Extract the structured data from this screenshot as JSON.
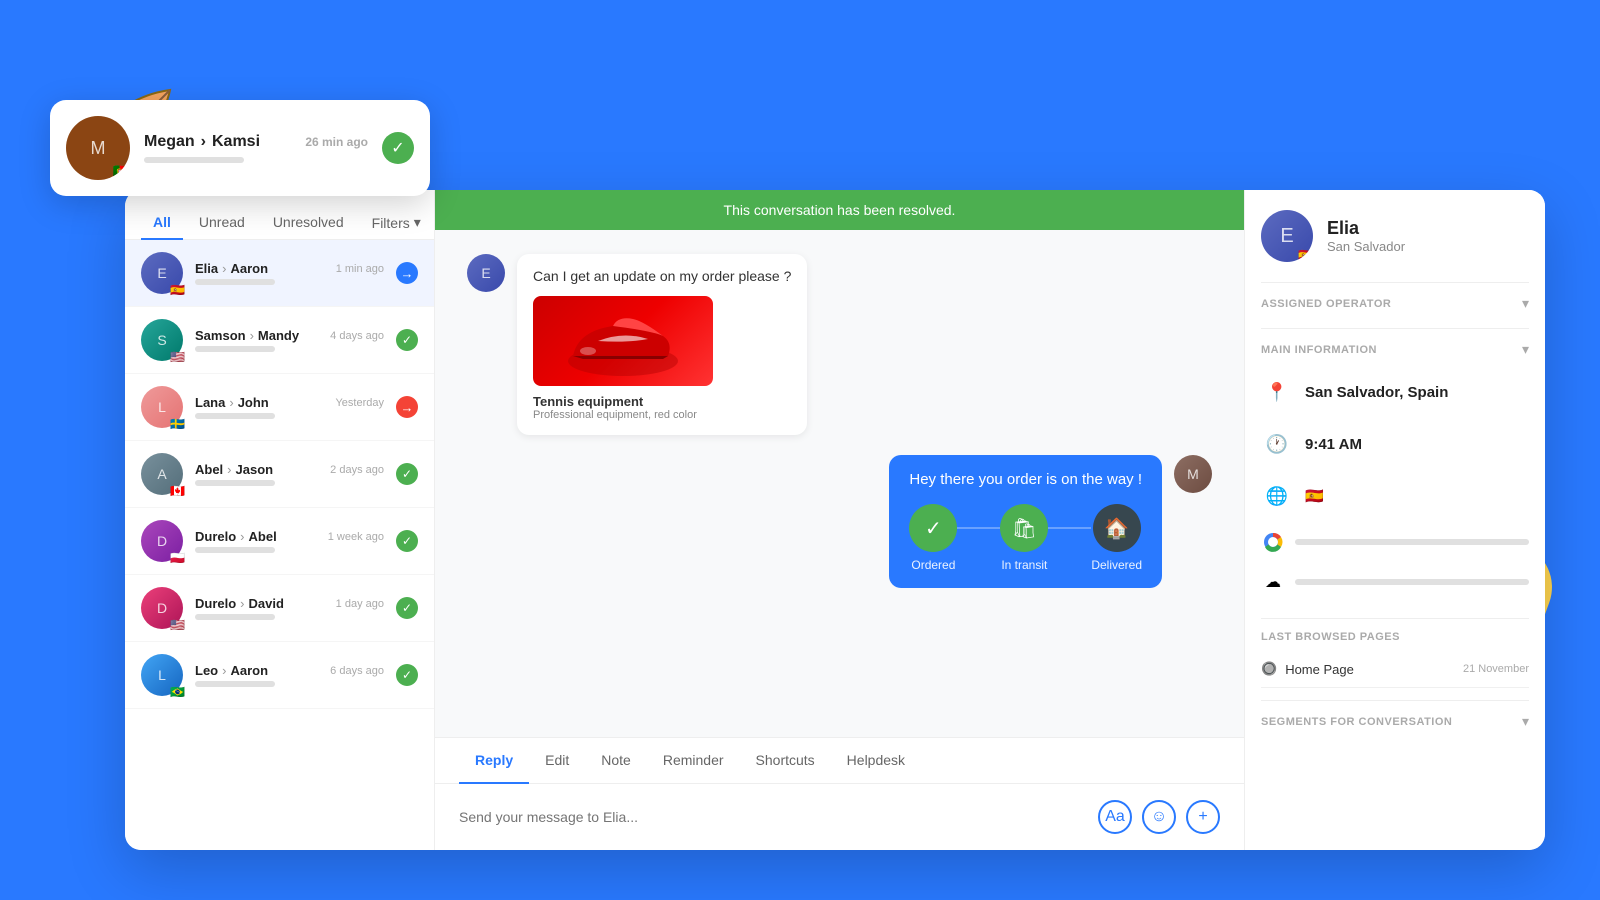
{
  "background_color": "#2979FF",
  "tabs": {
    "all": "All",
    "unread": "Unread",
    "unresolved": "Unresolved",
    "filters": "Filters"
  },
  "conversations": [
    {
      "id": "elia-aaron",
      "from": "Elia",
      "to": "Aaron",
      "time": "1 min ago",
      "flag": "🇪🇸",
      "status": "arrow",
      "avatar_class": "av-elia",
      "active": true
    },
    {
      "id": "samson-mandy",
      "from": "Samson",
      "to": "Mandy",
      "time": "4 days ago",
      "flag": "🇺🇸",
      "status": "check",
      "avatar_class": "av-samson"
    },
    {
      "id": "lana-john",
      "from": "Lana",
      "to": "John",
      "time": "Yesterday",
      "flag": "🇸🇪",
      "status": "dot",
      "avatar_class": "av-lana"
    },
    {
      "id": "abel-jason",
      "from": "Abel",
      "to": "Jason",
      "time": "2 days ago",
      "flag": "🇨🇦",
      "status": "check",
      "avatar_class": "av-abel"
    },
    {
      "id": "durelo-abel",
      "from": "Durelo",
      "to": "Abel",
      "time": "1 week ago",
      "flag": "🇵🇱",
      "status": "check",
      "avatar_class": "av-durelo"
    },
    {
      "id": "durelo-david",
      "from": "Durelo",
      "to": "David",
      "time": "1 day ago",
      "flag": "🇺🇸",
      "status": "check",
      "avatar_class": "av-durelo2"
    },
    {
      "id": "leo-aaron",
      "from": "Leo",
      "to": "Aaron",
      "time": "6 days ago",
      "flag": "🇧🇷",
      "status": "check",
      "avatar_class": "av-leo"
    }
  ],
  "floating_card": {
    "from": "Megan",
    "to": "Kamsi",
    "time": "26 min ago",
    "avatar_class": "av-megan",
    "flag": "🇵🇹"
  },
  "resolved_banner": "This conversation has been resolved.",
  "chat": {
    "incoming_message": "Can I get an update on my order please ?",
    "product": {
      "name": "Tennis equipment",
      "description": "Professional equipment, red color"
    },
    "outgoing_message": "Hey there you order is on the way !",
    "order_steps": [
      {
        "label": "Ordered",
        "icon": "✓",
        "state": "done"
      },
      {
        "label": "In transit",
        "icon": "🛍",
        "state": "transit"
      },
      {
        "label": "Delivered",
        "icon": "🏠",
        "state": "delivered"
      }
    ]
  },
  "reply_tabs": [
    "Reply",
    "Edit",
    "Note",
    "Reminder",
    "Shortcuts",
    "Helpdesk"
  ],
  "reply_input_placeholder": "Send your message to Elia...",
  "contact": {
    "name": "Elia",
    "location_city": "San Salvador",
    "flag": "🇪🇸",
    "main_info": {
      "location": "San Salvador, Spain",
      "time": "9:41 AM",
      "language_flag": "🇪🇸"
    }
  },
  "sections": {
    "assigned_operator": "ASSIGNED OPERATOR",
    "main_information": "MAIN INFORMATION",
    "last_browsed_pages": "LAST BROWSED PAGES",
    "segments": "SEGMENTS FOR CONVERSATION"
  },
  "last_browsed": [
    {
      "page": "Home Page",
      "date": "21 November"
    }
  ]
}
